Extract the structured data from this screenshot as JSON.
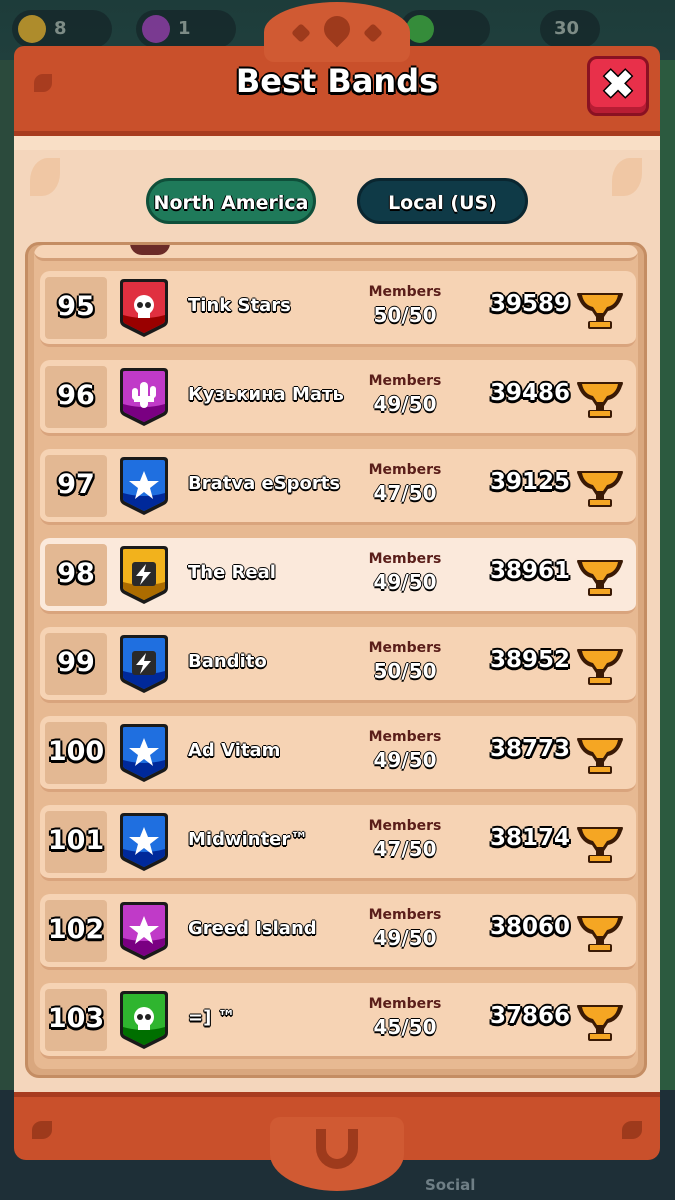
{
  "topbar": {
    "counters": [
      "8",
      "1",
      "30"
    ]
  },
  "modal": {
    "title": "Best Bands",
    "close_label": "✖"
  },
  "tabs": [
    {
      "label": "North America",
      "active": true,
      "color": "#1f7a5a"
    },
    {
      "label": "Local (US)",
      "active": false,
      "color": "#0f3a47"
    }
  ],
  "members_label": "Members",
  "rows": [
    {
      "rank": "95",
      "name": "Tink Stars",
      "members": "50/50",
      "trophies": "39589",
      "badge": {
        "color": "#e03040",
        "icon": "skull-icon"
      },
      "highlight": false
    },
    {
      "rank": "96",
      "name": "Кузькина Мать",
      "members": "49/50",
      "trophies": "39486",
      "badge": {
        "color": "#c03ac8",
        "icon": "cactus-icon"
      },
      "highlight": false
    },
    {
      "rank": "97",
      "name": "Bratva eSports",
      "members": "47/50",
      "trophies": "39125",
      "badge": {
        "color": "#1f6fe0",
        "icon": "star-icon"
      },
      "highlight": false
    },
    {
      "rank": "98",
      "name": "The Real",
      "members": "49/50",
      "trophies": "38961",
      "badge": {
        "color": "#f2b21c",
        "icon": "lightning-icon"
      },
      "highlight": true
    },
    {
      "rank": "99",
      "name": "Bandito",
      "members": "50/50",
      "trophies": "38952",
      "badge": {
        "color": "#1f6fe0",
        "icon": "lightning-icon"
      },
      "highlight": false
    },
    {
      "rank": "100",
      "name": "Ad Vitam",
      "members": "49/50",
      "trophies": "38773",
      "badge": {
        "color": "#1f6fe0",
        "icon": "star-icon"
      },
      "highlight": false
    },
    {
      "rank": "101",
      "name": "Midwinter™",
      "members": "47/50",
      "trophies": "38174",
      "badge": {
        "color": "#1f6fe0",
        "icon": "star-icon"
      },
      "highlight": false
    },
    {
      "rank": "102",
      "name": "Greed Island",
      "members": "49/50",
      "trophies": "38060",
      "badge": {
        "color": "#c03ac8",
        "icon": "star-icon"
      },
      "highlight": false
    },
    {
      "rank": "103",
      "name": "=] ™",
      "members": "45/50",
      "trophies": "37866",
      "badge": {
        "color": "#2fb52f",
        "icon": "skull-icon"
      },
      "highlight": false
    }
  ],
  "bottom_nav": {
    "social_label": "Social"
  },
  "colors": {
    "header": "#c9502b",
    "panel": "#f4d6bc",
    "trophy": "#f5a623"
  }
}
